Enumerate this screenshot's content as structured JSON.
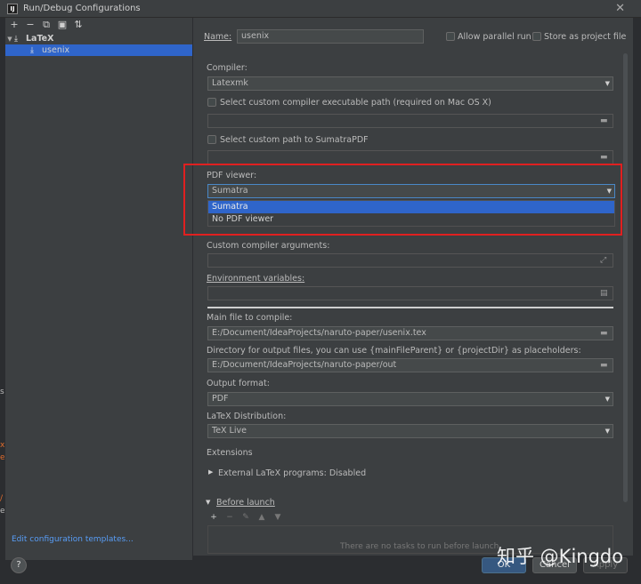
{
  "window": {
    "title": "Run/Debug Configurations",
    "app_icon_text": "IJ"
  },
  "left_toolbar": [
    "+",
    "−",
    "⧉",
    "▣",
    "⇅"
  ],
  "tree": {
    "group": {
      "label": "LaTeX"
    },
    "item": {
      "label": "usenix"
    }
  },
  "edit_templates_link": "Edit configuration templates...",
  "help_label": "?",
  "name_row": {
    "label": "Name:",
    "value": "usenix",
    "allow_parallel": "Allow parallel run",
    "store_as_project": "Store as project file"
  },
  "compiler": {
    "label": "Compiler:",
    "value": "Latexmk"
  },
  "custom_compiler_path": {
    "label": "Select custom compiler executable path (required on Mac OS X)",
    "value": ""
  },
  "custom_sumatra": {
    "label": "Select custom path to SumatraPDF",
    "value": ""
  },
  "pdf_viewer": {
    "label": "PDF viewer:",
    "value": "Sumatra",
    "options": [
      "Sumatra",
      "No PDF viewer"
    ],
    "selected_option": "Sumatra"
  },
  "custom_args": {
    "label": "Custom compiler arguments:",
    "value": ""
  },
  "env_vars": {
    "label": "Environment variables:",
    "value": ""
  },
  "main_file": {
    "label": "Main file to compile:",
    "value": "E:/Document/IdeaProjects/naruto-paper/usenix.tex"
  },
  "output_dir": {
    "label": "Directory for output files, you can use {mainFileParent} or {projectDir} as placeholders:",
    "value": "E:/Document/IdeaProjects/naruto-paper/out"
  },
  "output_format": {
    "label": "Output format:",
    "value": "PDF"
  },
  "distribution": {
    "label": "LaTeX Distribution:",
    "value": "TeX Live"
  },
  "extensions": {
    "label": "Extensions",
    "external_programs": "External LaTeX programs: Disabled"
  },
  "before_launch": {
    "label": "Before launch",
    "empty_text": "There are no tasks to run before launch"
  },
  "before_launch_toolbar": [
    "+",
    "−",
    "✎",
    "▲",
    "▼"
  ],
  "buttons": {
    "ok": "OK",
    "cancel": "Cancel",
    "apply": "Apply"
  },
  "watermark": "知乎 @Kingdo",
  "colors": {
    "highlight": "#2f65ca",
    "annotation_box": "#e02020",
    "link": "#589df6"
  }
}
